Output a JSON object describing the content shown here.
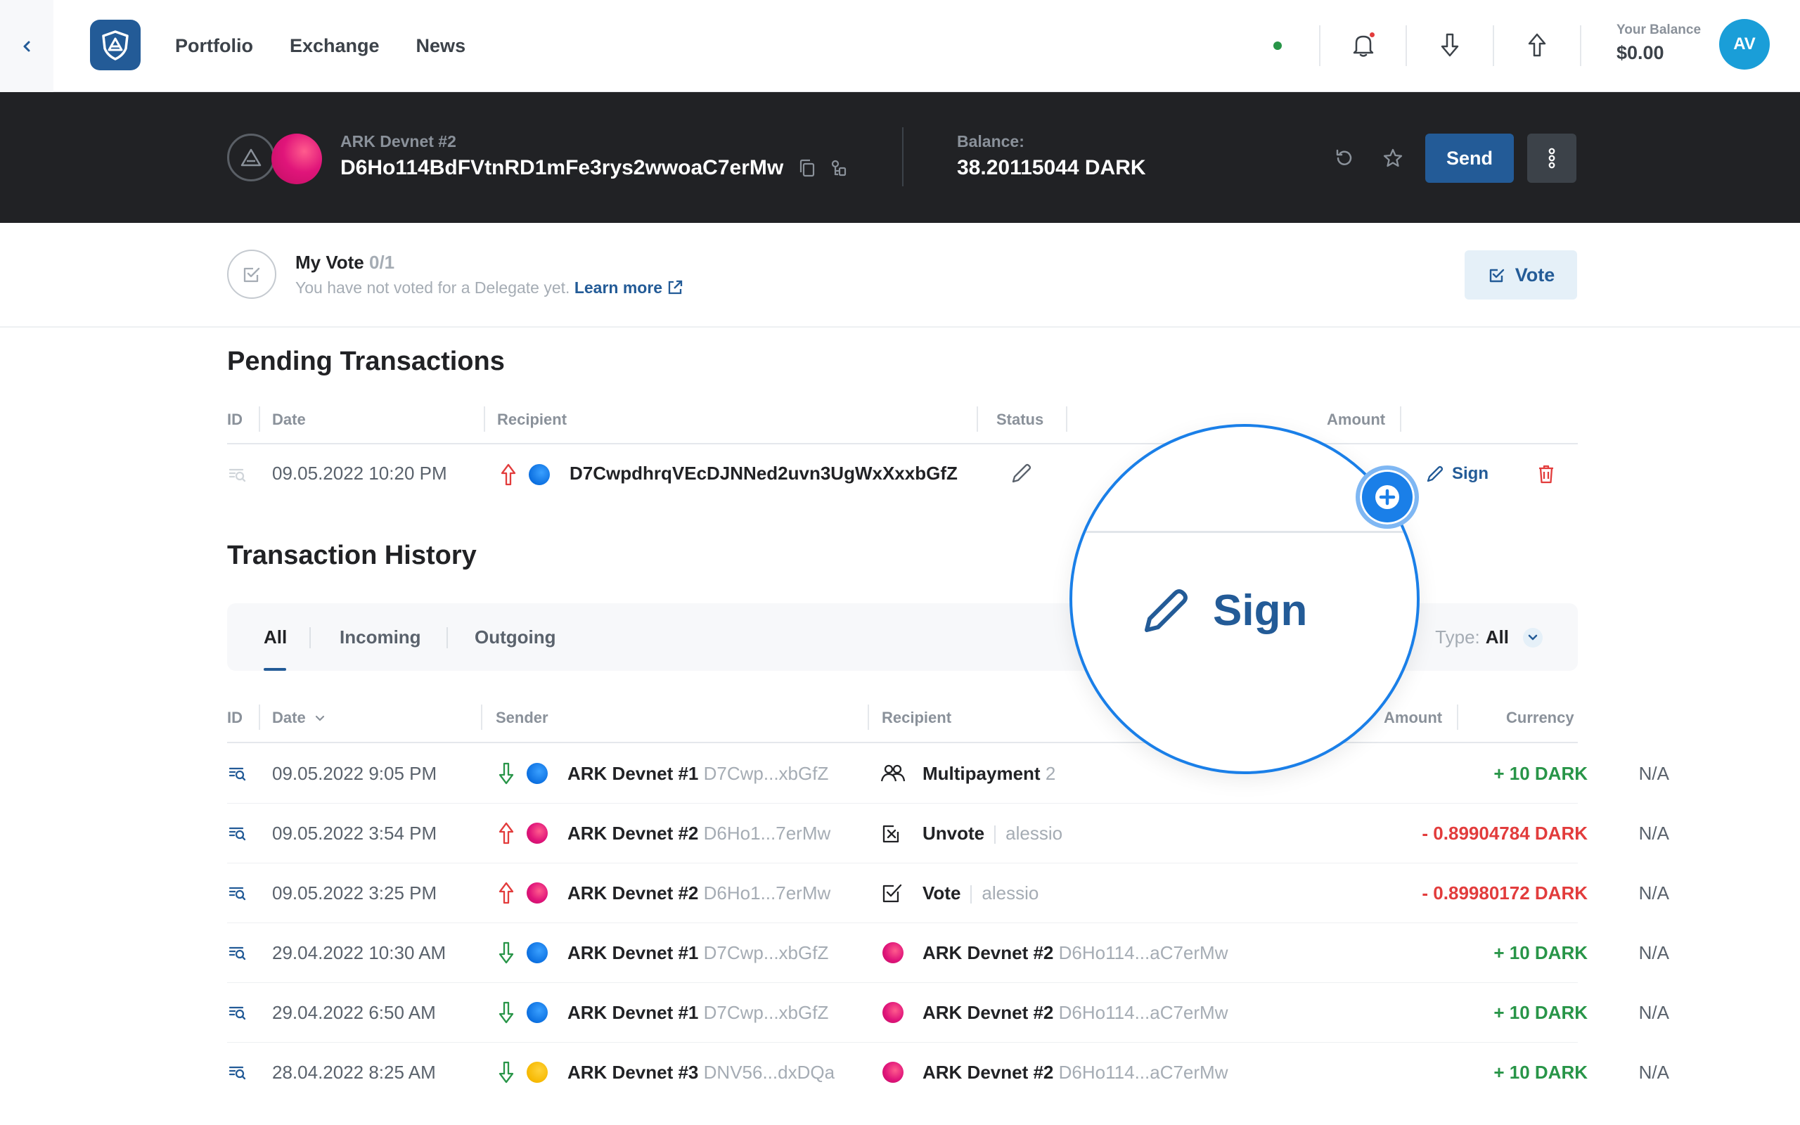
{
  "nav": {
    "links": [
      "Portfolio",
      "Exchange",
      "News"
    ],
    "balance_label": "Your Balance",
    "balance_value": "$0.00",
    "avatar_initials": "AV"
  },
  "wallet": {
    "network_name": "ARK Devnet #2",
    "address": "D6Ho114BdFVtnRD1mFe3rys2wwoaC7erMw",
    "balance_label": "Balance:",
    "balance_value": "38.20115044 DARK",
    "send_label": "Send"
  },
  "vote": {
    "title": "My Vote",
    "count": "0/1",
    "subtitle": "You have not voted for a Delegate yet.",
    "learn_more": "Learn more",
    "button_label": "Vote"
  },
  "pending": {
    "title": "Pending Transactions",
    "headers": [
      "ID",
      "Date",
      "Recipient",
      "Status",
      "Amount"
    ],
    "row": {
      "date": "09.05.2022 10:20 PM",
      "recipient": "D7CwpdhrqVEcDJNNed2uvn3UgWxXxxbGfZ",
      "sign_label": "Sign"
    }
  },
  "history": {
    "title": "Transaction History",
    "tabs": [
      "All",
      "Incoming",
      "Outgoing"
    ],
    "type_label": "Type:",
    "type_value": "All",
    "headers": [
      "ID",
      "Date",
      "Sender",
      "Recipient",
      "Amount",
      "Currency"
    ],
    "rows": [
      {
        "date": "09.05.2022 9:05 PM",
        "sender_name": "ARK Devnet #1",
        "sender_short": "D7Cwp...xbGfZ",
        "recipient_name": "Multipayment",
        "recipient_extra": "2",
        "amount": "+ 10 DARK",
        "currency": "N/A"
      },
      {
        "date": "09.05.2022 3:54 PM",
        "sender_name": "ARK Devnet #2",
        "sender_short": "D6Ho1...7erMw",
        "recipient_name": "Unvote",
        "recipient_extra": "alessio",
        "amount": "- 0.89904784 DARK",
        "currency": "N/A"
      },
      {
        "date": "09.05.2022 3:25 PM",
        "sender_name": "ARK Devnet #2",
        "sender_short": "D6Ho1...7erMw",
        "recipient_name": "Vote",
        "recipient_extra": "alessio",
        "amount": "- 0.89980172 DARK",
        "currency": "N/A"
      },
      {
        "date": "29.04.2022 10:30 AM",
        "sender_name": "ARK Devnet #1",
        "sender_short": "D7Cwp...xbGfZ",
        "recipient_name": "ARK Devnet #2",
        "recipient_extra": "D6Ho114...aC7erMw",
        "amount": "+ 10 DARK",
        "currency": "N/A"
      },
      {
        "date": "29.04.2022 6:50 AM",
        "sender_name": "ARK Devnet #1",
        "sender_short": "D7Cwp...xbGfZ",
        "recipient_name": "ARK Devnet #2",
        "recipient_extra": "D6Ho114...aC7erMw",
        "amount": "+ 10 DARK",
        "currency": "N/A"
      },
      {
        "date": "28.04.2022 8:25 AM",
        "sender_name": "ARK Devnet #3",
        "sender_short": "DNV56...dxDQa",
        "recipient_name": "ARK Devnet #2",
        "recipient_extra": "D6Ho114...aC7erMw",
        "amount": "+ 10 DARK",
        "currency": "N/A"
      }
    ]
  },
  "magnifier": {
    "label": "Sign"
  },
  "colors": {
    "primary": "#235b97",
    "positive": "#289548",
    "negative": "#e23c3c",
    "accent": "#1a7fe8",
    "dark_header": "#212225"
  }
}
